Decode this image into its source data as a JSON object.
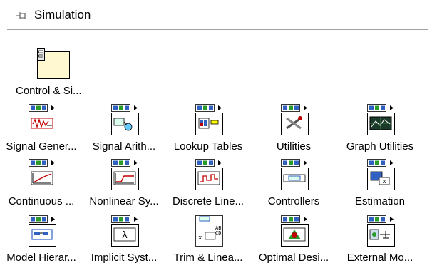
{
  "palette": {
    "title": "Simulation",
    "folder": {
      "label": "Control & Si...",
      "icon": "folder-icon"
    },
    "items": [
      {
        "label": "Signal Gener...",
        "icon": "signal-generator-icon"
      },
      {
        "label": "Signal Arith...",
        "icon": "signal-arithmetic-icon"
      },
      {
        "label": "Lookup Tables",
        "icon": "lookup-tables-icon"
      },
      {
        "label": "Utilities",
        "icon": "utilities-icon"
      },
      {
        "label": "Graph Utilities",
        "icon": "graph-utilities-icon"
      },
      {
        "label": "Continuous ...",
        "icon": "continuous-icon"
      },
      {
        "label": "Nonlinear Sy...",
        "icon": "nonlinear-systems-icon"
      },
      {
        "label": "Discrete Line...",
        "icon": "discrete-linear-icon"
      },
      {
        "label": "Controllers",
        "icon": "controllers-icon"
      },
      {
        "label": "Estimation",
        "icon": "estimation-icon"
      },
      {
        "label": "Model Hierar...",
        "icon": "model-hierarchy-icon"
      },
      {
        "label": "Implicit Syst...",
        "icon": "implicit-systems-icon"
      },
      {
        "label": "Trim & Linea...",
        "icon": "trim-linearize-icon"
      },
      {
        "label": "Optimal Desi...",
        "icon": "optimal-design-icon"
      },
      {
        "label": "External Mo...",
        "icon": "external-models-icon"
      }
    ]
  }
}
